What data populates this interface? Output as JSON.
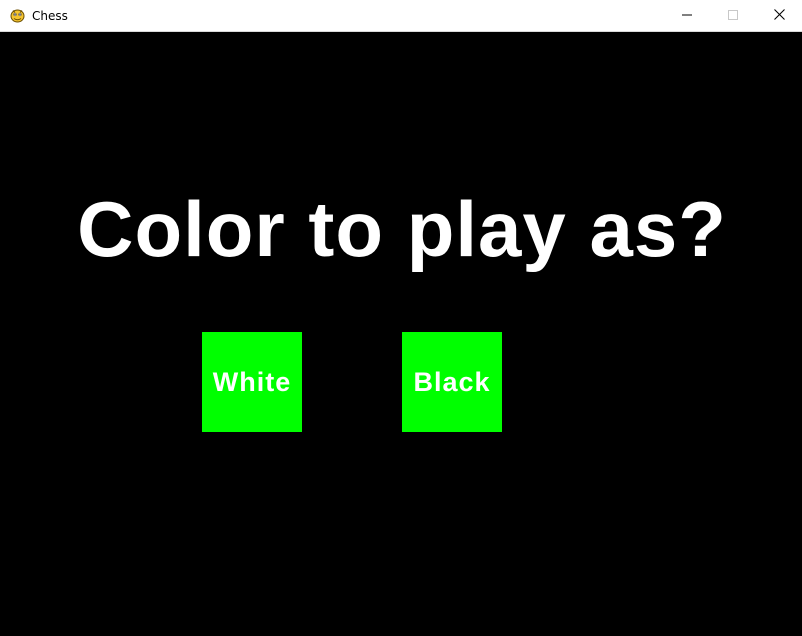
{
  "window": {
    "title": "Chess",
    "icon": "pygame-snake-icon",
    "controls": {
      "minimize_icon": "minimize-icon",
      "maximize_icon": "maximize-icon",
      "close_icon": "close-icon"
    }
  },
  "screen": {
    "background": "#000000",
    "heading": "Color to play as?",
    "heading_color": "#ffffff",
    "options": [
      {
        "label": "White",
        "color": "#00ff00",
        "text_color": "#ffffff"
      },
      {
        "label": "Black",
        "color": "#00ff00",
        "text_color": "#ffffff"
      }
    ]
  }
}
